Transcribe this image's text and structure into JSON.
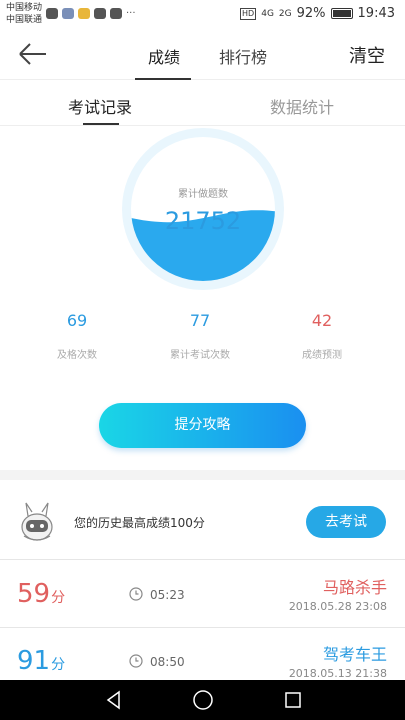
{
  "status_bar": {
    "carrier_1": "中国移动",
    "carrier_2": "中国联通",
    "hd": "HD",
    "signal_1": "4G",
    "signal_2": "2G",
    "battery": "92%",
    "time": "19:43"
  },
  "header": {
    "tab_score": "成绩",
    "tab_rank": "排行榜",
    "clear": "清空"
  },
  "subtabs": {
    "record": "考试记录",
    "stats": "数据统计"
  },
  "gauge": {
    "label": "累计做题数",
    "value": "21752",
    "fill_fraction": 0.45
  },
  "stats": [
    {
      "value": "69",
      "label": "及格次数"
    },
    {
      "value": "77",
      "label": "累计考试次数"
    },
    {
      "value": "42",
      "label": "成绩预测"
    }
  ],
  "cta_label": "提分攻略",
  "best": {
    "text": "您的历史最高成绩100分",
    "button": "去考试"
  },
  "records": [
    {
      "score": "59",
      "unit": "分",
      "time": "05:23",
      "title": "马路杀手",
      "date": "2018.05.28  23:08",
      "color": "#e0605f"
    },
    {
      "score": "91",
      "unit": "分",
      "time": "08:50",
      "title": "驾考车王",
      "date": "2018.05.13  21:38",
      "color": "#2b9be0"
    }
  ],
  "colors": {
    "accent": "#2b9be0",
    "warning": "#e0605f"
  }
}
